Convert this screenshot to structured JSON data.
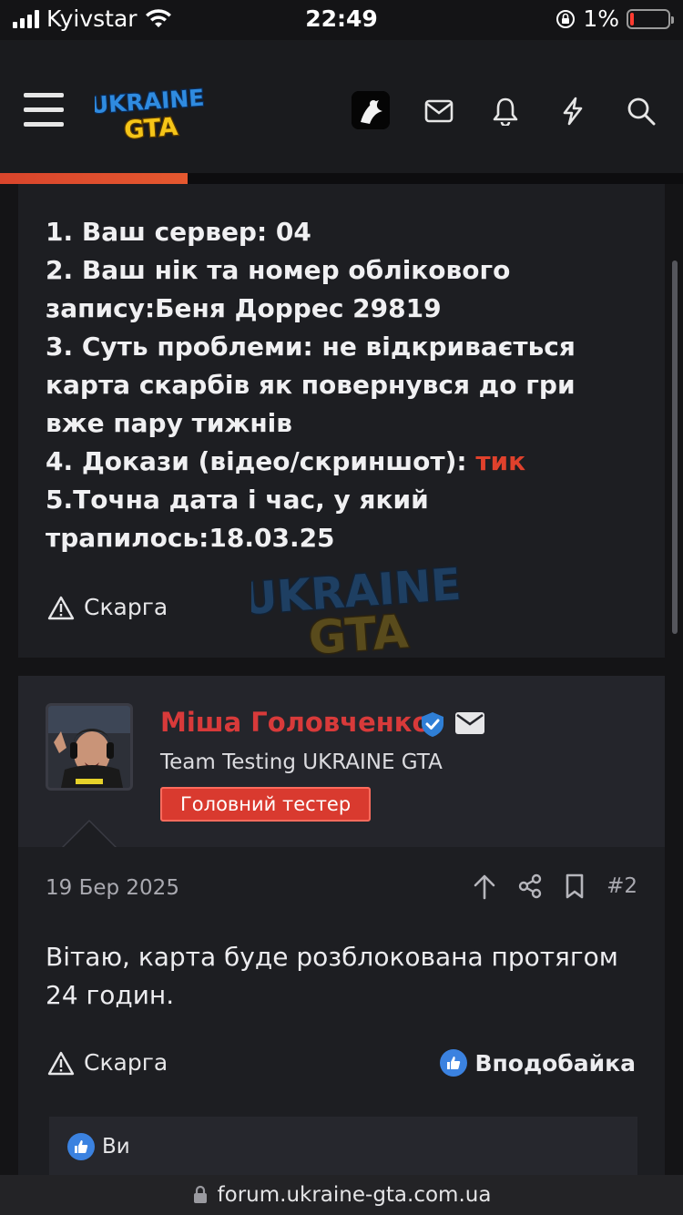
{
  "status_bar": {
    "carrier": "Kyivstar",
    "time": "22:49",
    "battery": "1%"
  },
  "header": {
    "logo_line1": "UKRAINE",
    "logo_line2": "GTA",
    "icons": [
      "menu-icon",
      "avatar",
      "mail-icon",
      "bell-icon",
      "bolt-icon",
      "search-icon"
    ],
    "progress": 0.275,
    "accent": "#e5582f"
  },
  "post1": {
    "lines": [
      {
        "text": "1. Ваш сервер: 04"
      },
      {
        "text": "2. Ваш нік та номер облікового запису:Беня Доррес 29819"
      },
      {
        "text": "3. Суть проблеми: не відкривається карта скарбів як повернувся до гри вже пару тижнів"
      },
      {
        "prefix": "4. Докази (відео/скриншот): ",
        "link": "тик"
      },
      {
        "text": "5.Точна дата і час, у який трапилось:18.03.25"
      }
    ],
    "report_label": "Скарга",
    "watermark_line1": "UKRAINE",
    "watermark_line2": "GTA"
  },
  "author": {
    "name": "Міша Головченко",
    "title": "Team Testing UKRAINE GTA",
    "badge": "Головний тестер",
    "name_color": "#d83a3a",
    "badge_color": "#d93a2f"
  },
  "post2": {
    "date": "19 Бер 2025",
    "number": "#2",
    "text": "Вітаю, карта буде розблокована протягом 24 годин.",
    "report_label": "Скарга",
    "like_label": "Вподобайка",
    "reactions_label": "Ви"
  },
  "url_bar": {
    "url": "forum.ukraine-gta.com.ua"
  }
}
